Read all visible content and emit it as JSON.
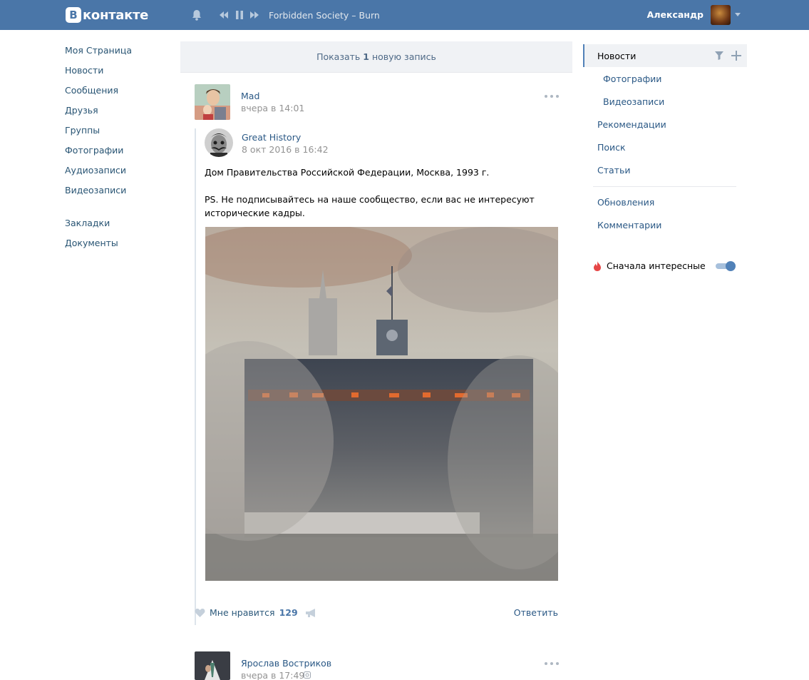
{
  "header": {
    "logo_letter": "В",
    "logo_text": "контакте",
    "track": "Forbidden Society – Burn",
    "user_name": "Александр"
  },
  "left_nav": {
    "items": [
      "Моя Страница",
      "Новости",
      "Сообщения",
      "Друзья",
      "Группы",
      "Фотографии",
      "Аудиозаписи",
      "Видеозаписи"
    ],
    "extra": [
      "Закладки",
      "Документы"
    ]
  },
  "feed": {
    "show_new_prefix": "Показать",
    "show_new_count": "1",
    "show_new_suffix": "новую запись",
    "post1": {
      "author": "Mad",
      "time": "вчера в 14:01",
      "repost_author": "Great History",
      "repost_time": "8 окт 2016 в 16:42",
      "text_line1": "Дом Правительства Российской Федерации, Москва, 1993 г.",
      "text_line2": "PS. Не подписывайтесь на наше сообщество, если вас не интересуют",
      "text_line3": "исторические кадры.",
      "like_label": "Мне нравится",
      "like_count": "129",
      "reply_label": "Ответить"
    },
    "post2": {
      "author": "Ярослав Востриков",
      "time": "вчера в 17:49"
    }
  },
  "right_nav": {
    "news": "Новости",
    "photos": "Фотографии",
    "videos": "Видеозаписи",
    "recommendations": "Рекомендации",
    "search": "Поиск",
    "articles": "Статьи",
    "updates": "Обновления",
    "comments": "Комментарии",
    "interesting_first": "Сначала интересные"
  },
  "colors": {
    "header_bg": "#4a76a8",
    "link": "#2a5885",
    "accent": "#5181b8"
  }
}
